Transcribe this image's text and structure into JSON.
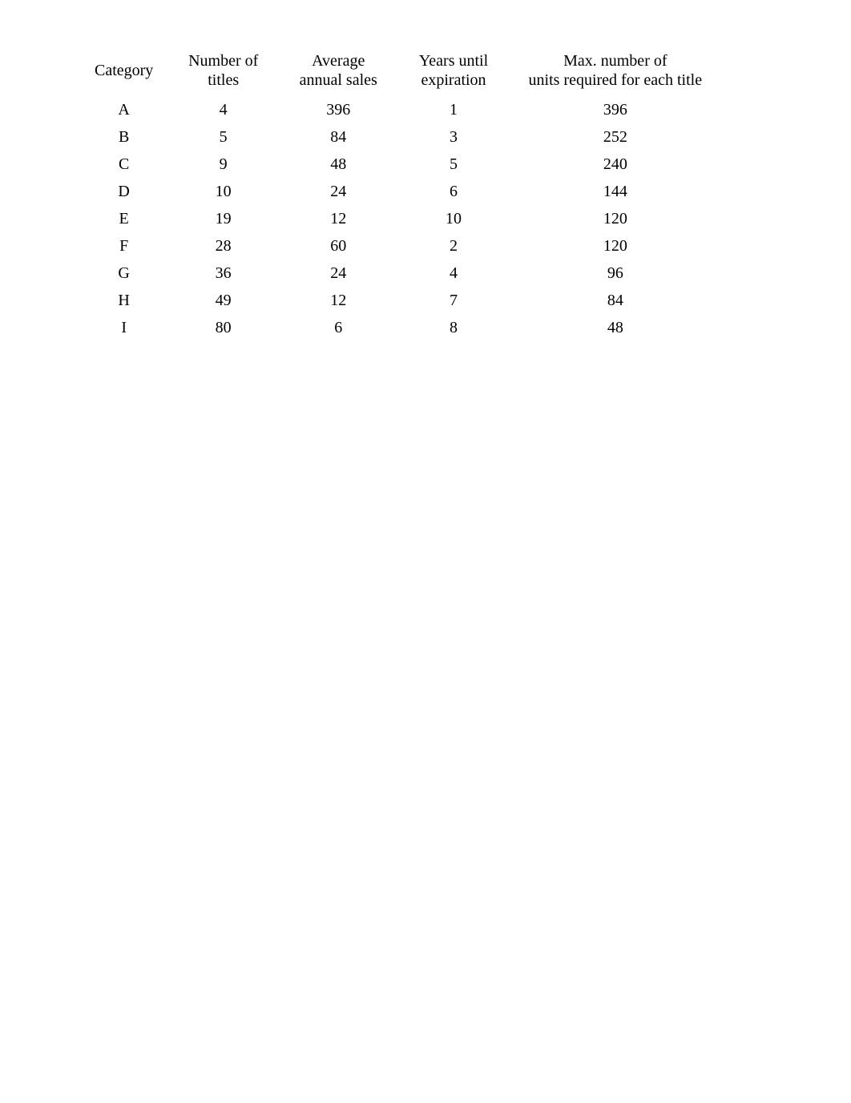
{
  "chart_data": {
    "type": "table",
    "title": "",
    "columns": [
      "Category",
      "Number of titles",
      "Average annual sales",
      "Years until expiration",
      "Max. number of units required for each title"
    ],
    "rows": [
      {
        "category": "A",
        "titles": 4,
        "sales": 396,
        "years": 1,
        "max_units": 396
      },
      {
        "category": "B",
        "titles": 5,
        "sales": 84,
        "years": 3,
        "max_units": 252
      },
      {
        "category": "C",
        "titles": 9,
        "sales": 48,
        "years": 5,
        "max_units": 240
      },
      {
        "category": "D",
        "titles": 10,
        "sales": 24,
        "years": 6,
        "max_units": 144
      },
      {
        "category": "E",
        "titles": 19,
        "sales": 12,
        "years": 10,
        "max_units": 120
      },
      {
        "category": "F",
        "titles": 28,
        "sales": 60,
        "years": 2,
        "max_units": 120
      },
      {
        "category": "G",
        "titles": 36,
        "sales": 24,
        "years": 4,
        "max_units": 96
      },
      {
        "category": "H",
        "titles": 49,
        "sales": 12,
        "years": 7,
        "max_units": 84
      },
      {
        "category": "I",
        "titles": 80,
        "sales": 6,
        "years": 8,
        "max_units": 48
      }
    ]
  },
  "headers": {
    "category": {
      "line1": "Category",
      "line2": ""
    },
    "titles": {
      "line1": "Number of",
      "line2": "titles"
    },
    "sales": {
      "line1": "Average",
      "line2": "annual sales"
    },
    "years": {
      "line1": "Years until",
      "line2": "expiration"
    },
    "max_units": {
      "line1": "Max. number of",
      "line2": "units required for each title"
    }
  }
}
